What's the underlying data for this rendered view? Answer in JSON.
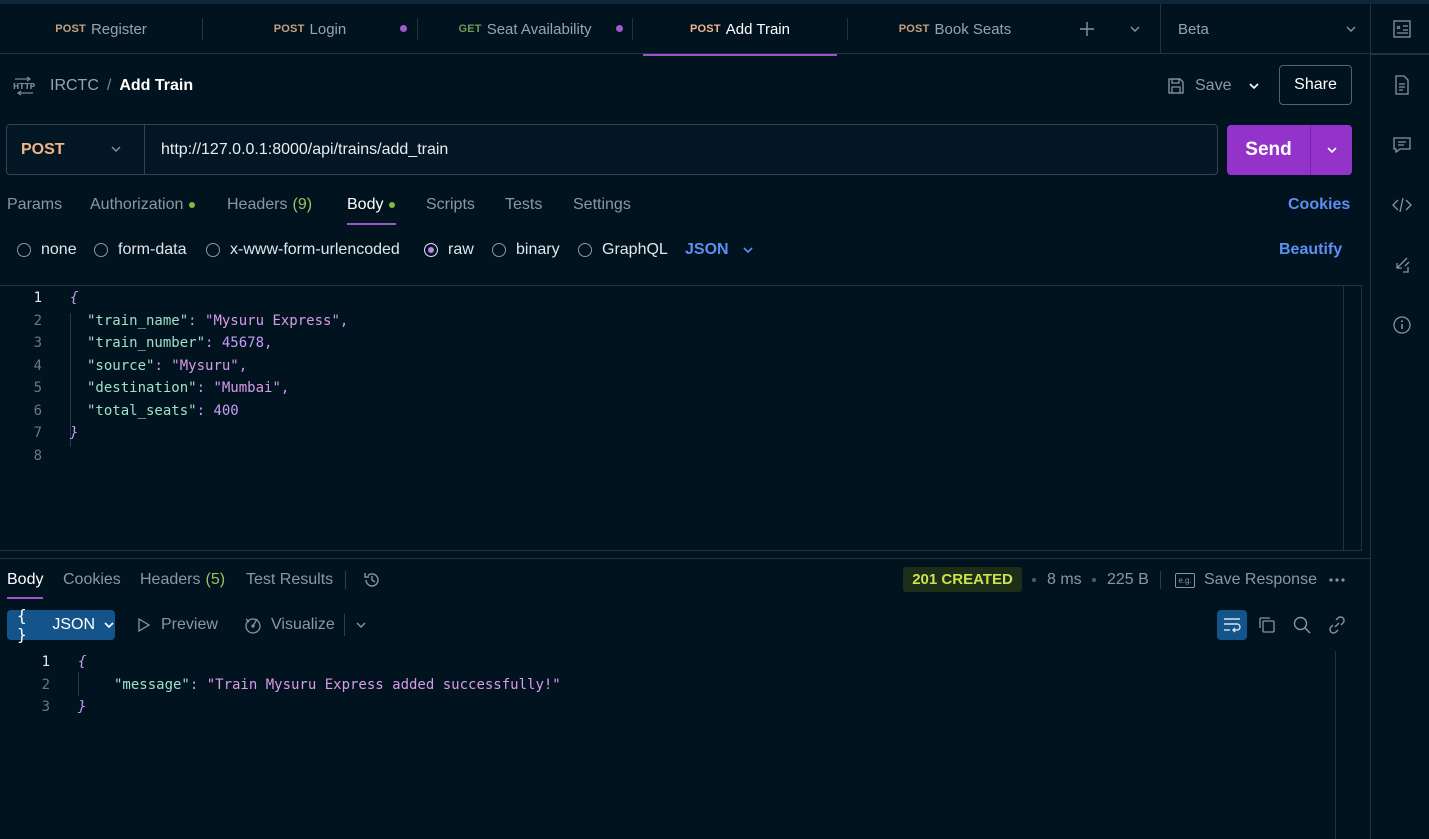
{
  "tabs": [
    {
      "method": "POST",
      "name": "Register"
    },
    {
      "method": "POST",
      "name": "Login"
    },
    {
      "method": "GET",
      "name": "Seat Availability"
    },
    {
      "method": "POST",
      "name": "Add Train"
    },
    {
      "method": "POST",
      "name": "Book Seats"
    }
  ],
  "environment": "Beta",
  "breadcrumb": {
    "collection": "IRCTC",
    "separator": "/",
    "request": "Add Train",
    "http_icon": "HTTP"
  },
  "toolbar": {
    "save_label": "Save",
    "share_label": "Share"
  },
  "request": {
    "method": "POST",
    "url": "http://127.0.0.1:8000/api/trains/add_train",
    "send_label": "Send"
  },
  "request_tabs": {
    "params": "Params",
    "authorization": "Authorization",
    "headers": "Headers",
    "headers_count": "(9)",
    "body": "Body",
    "scripts": "Scripts",
    "tests": "Tests",
    "settings": "Settings",
    "cookies": "Cookies"
  },
  "body_types": {
    "none": "none",
    "form_data": "form-data",
    "urlencoded": "x-www-form-urlencoded",
    "raw": "raw",
    "binary": "binary",
    "graphql": "GraphQL",
    "format": "JSON",
    "beautify": "Beautify"
  },
  "request_body": {
    "line_numbers": [
      "1",
      "2",
      "3",
      "4",
      "5",
      "6",
      "7",
      "8"
    ],
    "open_brace": "{",
    "close_brace": "}",
    "fields": [
      {
        "key": "\"train_name\"",
        "sep": ": ",
        "value": "\"Mysuru Express\"",
        "type": "string",
        "comma": ","
      },
      {
        "key": "\"train_number\"",
        "sep": ": ",
        "value": "45678",
        "type": "number",
        "comma": ","
      },
      {
        "key": "\"source\"",
        "sep": ": ",
        "value": "\"Mysuru\"",
        "type": "string",
        "comma": ","
      },
      {
        "key": "\"destination\"",
        "sep": ": ",
        "value": "\"Mumbai\"",
        "type": "string",
        "comma": ","
      },
      {
        "key": "\"total_seats\"",
        "sep": ": ",
        "value": "400",
        "type": "number",
        "comma": ""
      }
    ]
  },
  "response_tabs": {
    "body": "Body",
    "cookies": "Cookies",
    "headers": "Headers",
    "headers_count": "(5)",
    "test_results": "Test Results"
  },
  "response_meta": {
    "status": "201 CREATED",
    "time": "8 ms",
    "size": "225 B",
    "save_response": "Save Response",
    "eg_badge": "e.g."
  },
  "response_view": {
    "format": "JSON",
    "format_icon": "{ }",
    "preview": "Preview",
    "visualize": "Visualize"
  },
  "response_body": {
    "line_numbers": [
      "1",
      "2",
      "3"
    ],
    "open_brace": "{",
    "close_brace": "}",
    "key": "\"message\"",
    "sep": ": ",
    "value": "\"Train Mysuru Express added successfully!\""
  },
  "colors": {
    "accent": "#9333c9",
    "post_method": "#f0b68a",
    "get_method": "#6f9a55",
    "status_bg": "#1d2e18",
    "status_text": "#cde24c",
    "link": "#5c8ff0"
  }
}
